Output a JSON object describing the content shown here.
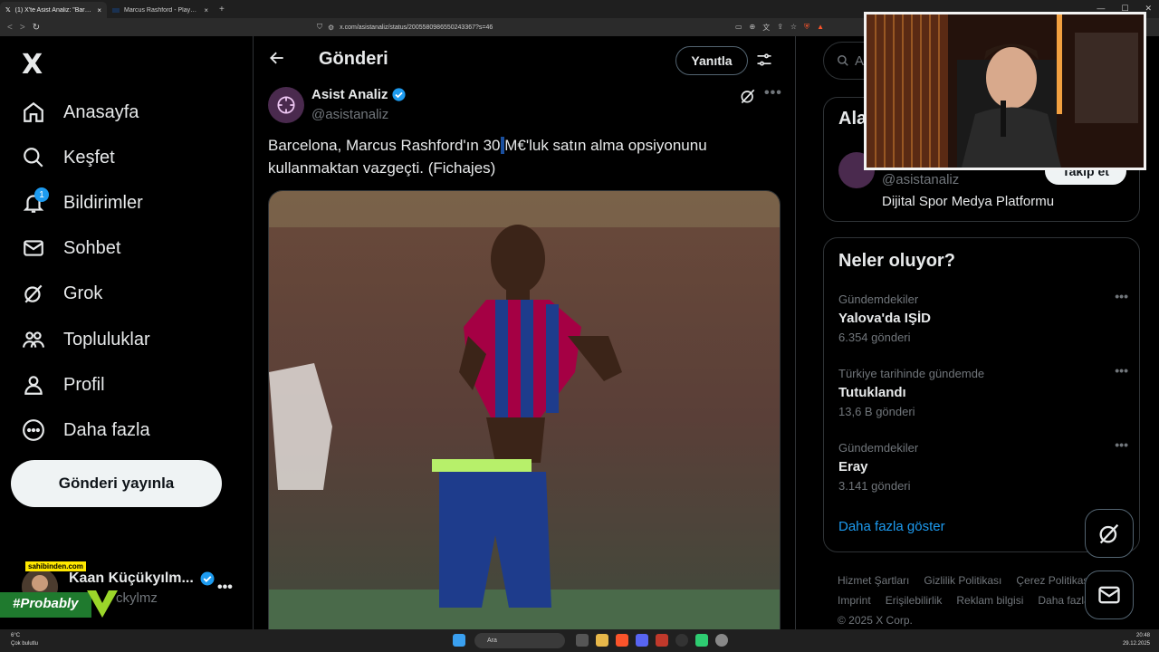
{
  "browser": {
    "tabs": [
      {
        "title": "(1) X'te Asist Analiz: \"Barcelona...",
        "close": "×"
      },
      {
        "title": "Marcus Rashford - Player profile 25/2...",
        "close": "×"
      }
    ],
    "new_tab": "+",
    "url": "x.com/asistanaliz/status/2005580986550243367?s=46"
  },
  "leftnav": {
    "logo": "X",
    "items": [
      {
        "label": "Anasayfa"
      },
      {
        "label": "Keşfet"
      },
      {
        "label": "Bildirimler",
        "badge": "1"
      },
      {
        "label": "Sohbet"
      },
      {
        "label": "Grok"
      },
      {
        "label": "Topluluklar"
      },
      {
        "label": "Profil"
      },
      {
        "label": "Daha fazla"
      }
    ],
    "post_button": "Gönderi yayınla",
    "account": {
      "name": "Kaan Küçükyılm...",
      "handle": "ckylmz",
      "more": "•••"
    },
    "overlay_sponsor": "sahibinden.com",
    "overlay_tag": "#Probably"
  },
  "main": {
    "title": "Gönderi",
    "reply_button": "Yanıtla",
    "post": {
      "author_name": "Asist Analiz",
      "author_handle": "@asistanaliz",
      "text_before": "Barcelona, Marcus Rashford'ın 30",
      "text_selected": " ",
      "text_after": "M€'luk satın alma opsiyonunu kullanmaktan vazgeçti. (Fichajes)",
      "more": "•••"
    }
  },
  "right": {
    "search_placeholder": "A",
    "card1": {
      "title": "Ala",
      "handle": "@asistanaliz",
      "follow": "Takip et",
      "bio": "Dijital Spor Medya Platformu"
    },
    "trends": {
      "title": "Neler oluyor?",
      "items": [
        {
          "category": "Gündemdekiler",
          "name": "Yalova'da IŞİD",
          "count": "6.354 gönderi"
        },
        {
          "category": "Türkiye tarihinde gündemde",
          "name": "Tutuklandı",
          "count": "13,6 B gönderi"
        },
        {
          "category": "Gündemdekiler",
          "name": "Eray",
          "count": "3.141 gönderi"
        }
      ],
      "show_more": "Daha fazla göster"
    },
    "footer": {
      "links": [
        "Hizmet Şartları",
        "Gizlilik Politikası",
        "Çerez Politikası",
        "Imprint",
        "Erişilebilirlik",
        "Reklam bilgisi",
        "Daha fazla"
      ],
      "copyright": "© 2025 X Corp."
    }
  },
  "taskbar": {
    "weather_temp": "6°C",
    "weather_desc": "Çok bulutlu",
    "search": "Ara",
    "time": "20:48",
    "date": "29.12.2025"
  },
  "colors": {
    "accent": "#1d9bf0",
    "background": "#000000",
    "text": "#e7e9ea",
    "muted": "#71767b",
    "border": "#2f3336"
  }
}
